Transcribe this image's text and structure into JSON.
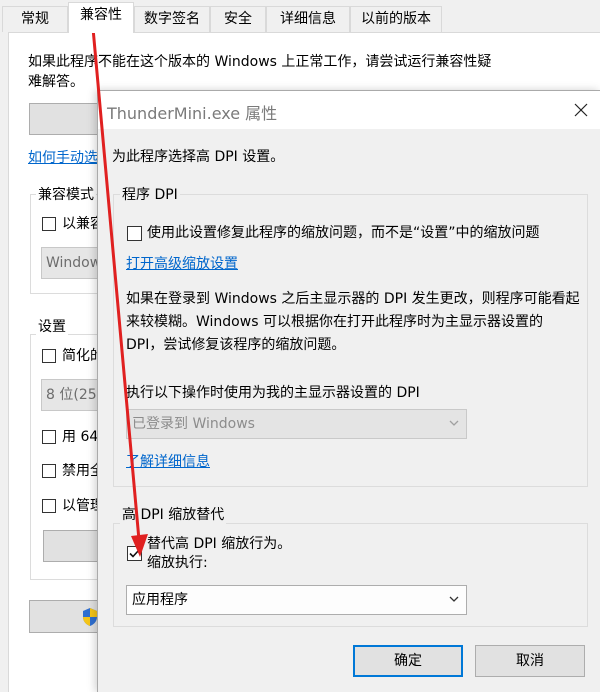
{
  "background_window": {
    "tabs": [
      {
        "label": "常规"
      },
      {
        "label": "兼容性"
      },
      {
        "label": "数字签名"
      },
      {
        "label": "安全"
      },
      {
        "label": "详细信息"
      },
      {
        "label": "以前的版本"
      }
    ],
    "intro_text": "如果此程序不能在这个版本的 Windows 上正常工作，请尝试运行兼容性疑难解答。",
    "manual_link": "如何手动选",
    "compat_group_label": "兼容模式",
    "compat_check_label": "以兼容",
    "compat_combo_value": "Window",
    "settings_group_label": "设置",
    "setting_items": [
      "简化的",
      "用 64",
      "禁用全",
      "以管理"
    ],
    "color_combo_value": "8 位(25"
  },
  "dialog": {
    "title": "ThunderMini.exe 属性",
    "subtitle": "为此程序选择高 DPI 设置。",
    "program_dpi": {
      "group_label": "程序 DPI",
      "check_label": "使用此设置修复此程序的缩放问题，而不是“设置”中的缩放问题",
      "checked": false,
      "advanced_link": "打开高级缩放设置",
      "description": "如果在登录到 Windows 之后主显示器的 DPI 发生更改，则程序可能看起来较模糊。Windows 可以根据你在打开此程序时为主显示器设置的 DPI，尝试修复该程序的缩放问题。",
      "dropdown_label": "执行以下操作时使用为我的主显示器设置的 DPI",
      "dropdown_value": "已登录到 Windows",
      "learn_more_link": "了解详细信息"
    },
    "high_dpi_override": {
      "group_label": "高 DPI 缩放替代",
      "check_label_line1": "替代高 DPI 缩放行为。",
      "check_label_line2": "缩放执行:",
      "checked": true,
      "dropdown_value": "应用程序"
    },
    "ok_label": "确定",
    "cancel_label": "取消"
  },
  "colors": {
    "annotation_red": "#e02020",
    "link_blue": "#0066cc",
    "default_button_border": "#0078d7"
  }
}
